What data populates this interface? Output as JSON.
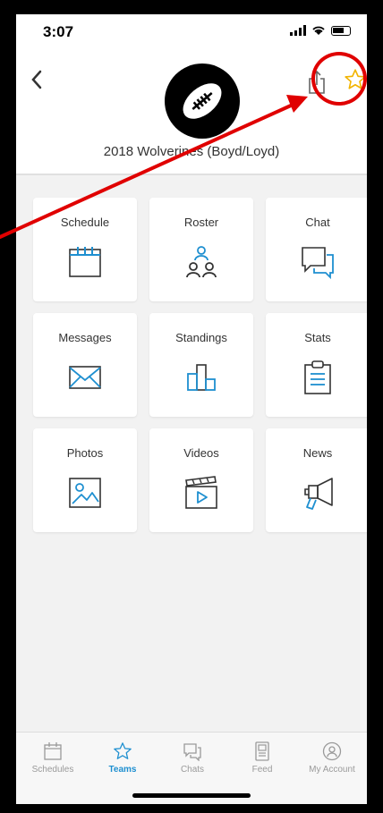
{
  "status_bar": {
    "time": "3:07"
  },
  "header": {
    "team_name": "2018 Wolverines (Boyd/Loyd)",
    "back_icon": "chevron-left-icon",
    "share_icon": "share-icon",
    "favorite_icon": "star-icon"
  },
  "tiles": [
    {
      "label": "Schedule",
      "icon": "calendar-icon"
    },
    {
      "label": "Roster",
      "icon": "people-icon"
    },
    {
      "label": "Chat",
      "icon": "chat-icon"
    },
    {
      "label": "Messages",
      "icon": "envelope-icon"
    },
    {
      "label": "Standings",
      "icon": "podium-icon"
    },
    {
      "label": "Stats",
      "icon": "clipboard-icon"
    },
    {
      "label": "Photos",
      "icon": "photo-icon"
    },
    {
      "label": "Videos",
      "icon": "clapperboard-icon"
    },
    {
      "label": "News",
      "icon": "megaphone-icon"
    }
  ],
  "tab_bar": {
    "tabs": [
      {
        "label": "Schedules",
        "icon": "calendar-icon",
        "active": false
      },
      {
        "label": "Teams",
        "icon": "star-icon",
        "active": true
      },
      {
        "label": "Chats",
        "icon": "chat-icon",
        "active": false
      },
      {
        "label": "Feed",
        "icon": "feed-icon",
        "active": false
      },
      {
        "label": "My Account",
        "icon": "account-icon",
        "active": false
      }
    ]
  },
  "colors": {
    "accent": "#1e8fd0",
    "favorite_star": "#f2b400",
    "annotation": "#e00000",
    "tab_inactive": "#9a9a9a"
  }
}
